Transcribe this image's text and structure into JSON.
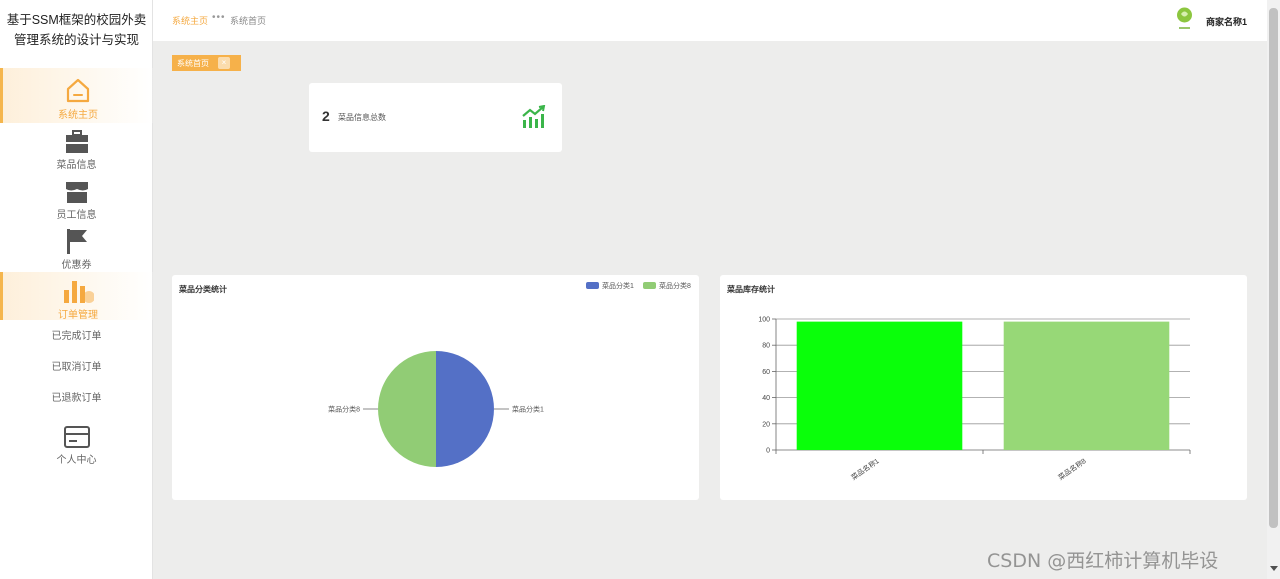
{
  "sidebar": {
    "title_line1": "基于SSM框架的校园外卖",
    "title_line2": "管理系统的设计与实现",
    "items": [
      {
        "label": "系统主页",
        "icon": "home-icon"
      },
      {
        "label": "菜品信息",
        "icon": "briefcase-icon"
      },
      {
        "label": "员工信息",
        "icon": "store-icon"
      },
      {
        "label": "优惠券",
        "icon": "flag-icon"
      },
      {
        "label": "订单管理",
        "icon": "bar-chart-icon"
      },
      {
        "label": "个人中心",
        "icon": "card-icon"
      }
    ],
    "sub_items": [
      "已完成订单",
      "已取消订单",
      "已退款订单"
    ]
  },
  "topbar": {
    "breadcrumb_home": "系统主页",
    "breadcrumb_separator": "•••",
    "breadcrumb_current": "系统首页",
    "merchant_name": "商家名称1"
  },
  "tag": {
    "label": "系统首页",
    "close": "×"
  },
  "stat": {
    "value": "2",
    "label": "菜品信息总数",
    "icon": "trend-up-icon"
  },
  "colors": {
    "accent": "#f5b64d",
    "pie_blue": "#5470c6",
    "pie_green": "#91cc75",
    "bar_bright": "#0aff0a",
    "bar_light": "#97d877"
  },
  "watermark": "CSDN @西红柿计算机毕设",
  "chart_data": [
    {
      "type": "pie",
      "title": "菜品分类统计",
      "legend": [
        "菜品分类1",
        "菜品分类8"
      ],
      "legend_position": "top-right",
      "slices": [
        {
          "name": "菜品分类1",
          "value": 1,
          "color": "#5470c6"
        },
        {
          "name": "菜品分类8",
          "value": 1,
          "color": "#91cc75"
        }
      ]
    },
    {
      "type": "bar",
      "title": "菜品库存统计",
      "categories": [
        "菜品名称1",
        "菜品名称8"
      ],
      "values": [
        98,
        98
      ],
      "colors": [
        "#0aff0a",
        "#97d877"
      ],
      "ylim": [
        0,
        100
      ],
      "yticks": [
        0,
        20,
        40,
        60,
        80,
        100
      ],
      "grid": true
    }
  ]
}
